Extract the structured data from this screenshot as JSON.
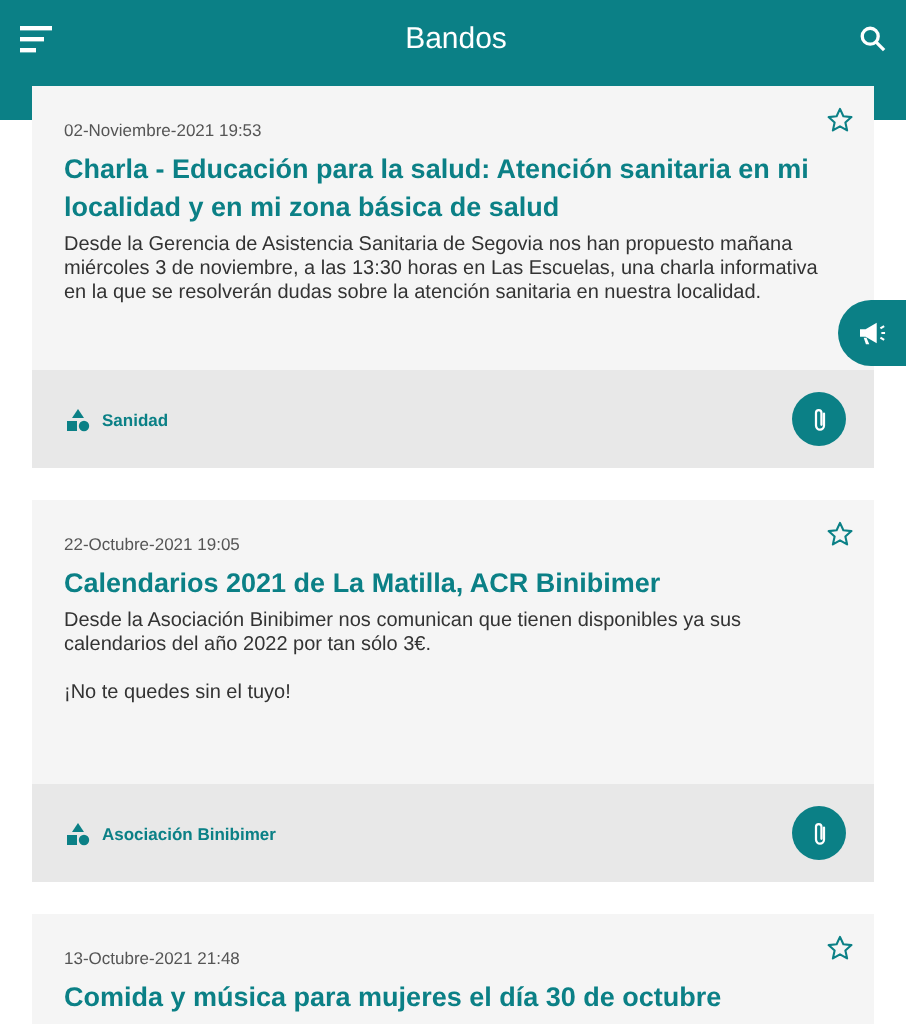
{
  "header": {
    "title": "Bandos"
  },
  "posts": [
    {
      "date": "02-Noviembre-2021 19:53",
      "favorite": false,
      "title": "Charla - Educación para la salud: Atención sanitaria en mi localidad y en mi zona básica de salud",
      "paragraphs": [
        "Desde la Gerencia de Asistencia Sanitaria de Segovia nos han propuesto mañana miércoles 3 de noviembre, a las 13:30 horas en Las Escuelas, una charla informativa en la que se resolverán dudas sobre la atención sanitaria en nuestra localidad."
      ],
      "category": "Sanidad",
      "attachment": true
    },
    {
      "date": "22-Octubre-2021 19:05",
      "favorite": false,
      "title": "Calendarios 2021 de La Matilla, ACR Binibimer",
      "paragraphs": [
        "Desde la Asociación Binibimer nos comunican que tienen disponibles ya sus calendarios del año 2022 por tan sólo 3€.",
        "¡No te quedes sin el tuyo!"
      ],
      "category": "Asociación Binibimer",
      "attachment": true
    },
    {
      "date": "13-Octubre-2021 21:48",
      "favorite": false,
      "title": "Comida y música para mujeres el día 30 de octubre"
    }
  ]
}
